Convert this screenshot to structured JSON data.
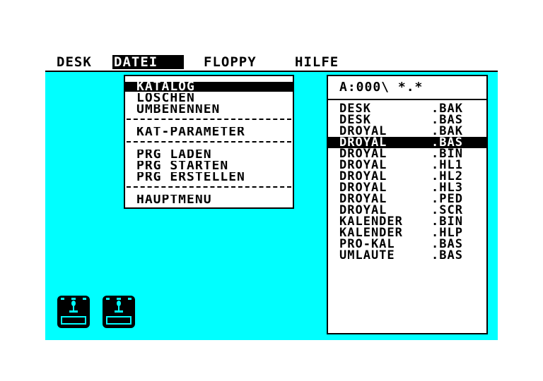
{
  "menubar": {
    "items": [
      {
        "label": "DESK",
        "active": false
      },
      {
        "label": "DATEI",
        "active": true
      },
      {
        "label": "FLOPPY",
        "active": false
      },
      {
        "label": "HILFE",
        "active": false
      }
    ]
  },
  "datei_menu": {
    "items": [
      "KATALOG",
      "LÖSCHEN",
      "UMBENENNEN",
      "KAT-PARAMETER",
      "PRG LADEN",
      "PRG STARTEN",
      "PRG ERSTELLEN",
      "HAUPTMENÜ"
    ],
    "selected": "KATALOG"
  },
  "file_window": {
    "path": "A:000\\ *.*",
    "files": [
      {
        "name": "DESK",
        "ext": ".BAK",
        "selected": false
      },
      {
        "name": "DESK",
        "ext": ".BAS",
        "selected": false
      },
      {
        "name": "DROYAL",
        "ext": ".BAK",
        "selected": false
      },
      {
        "name": "DROYAL",
        "ext": ".BAS",
        "selected": true
      },
      {
        "name": "DROYAL",
        "ext": ".BIN",
        "selected": false
      },
      {
        "name": "DROYAL",
        "ext": ".HL1",
        "selected": false
      },
      {
        "name": "DROYAL",
        "ext": ".HL2",
        "selected": false
      },
      {
        "name": "DROYAL",
        "ext": ".HL3",
        "selected": false
      },
      {
        "name": "DROYAL",
        "ext": ".PED",
        "selected": false
      },
      {
        "name": "DROYAL",
        "ext": ".SCR",
        "selected": false
      },
      {
        "name": "KALENDER",
        "ext": ".BIN",
        "selected": false
      },
      {
        "name": "KALENDER",
        "ext": ".HLP",
        "selected": false
      },
      {
        "name": "PRO-KAL",
        "ext": ".BAS",
        "selected": false
      },
      {
        "name": "UMLAUTE",
        "ext": ".BAS",
        "selected": false
      }
    ]
  },
  "drives": [
    {
      "icon": "floppy-drive-icon"
    },
    {
      "icon": "floppy-drive-icon"
    }
  ],
  "colors": {
    "desktop": "#00ffff",
    "background": "#ffffff",
    "foreground": "#000000"
  }
}
